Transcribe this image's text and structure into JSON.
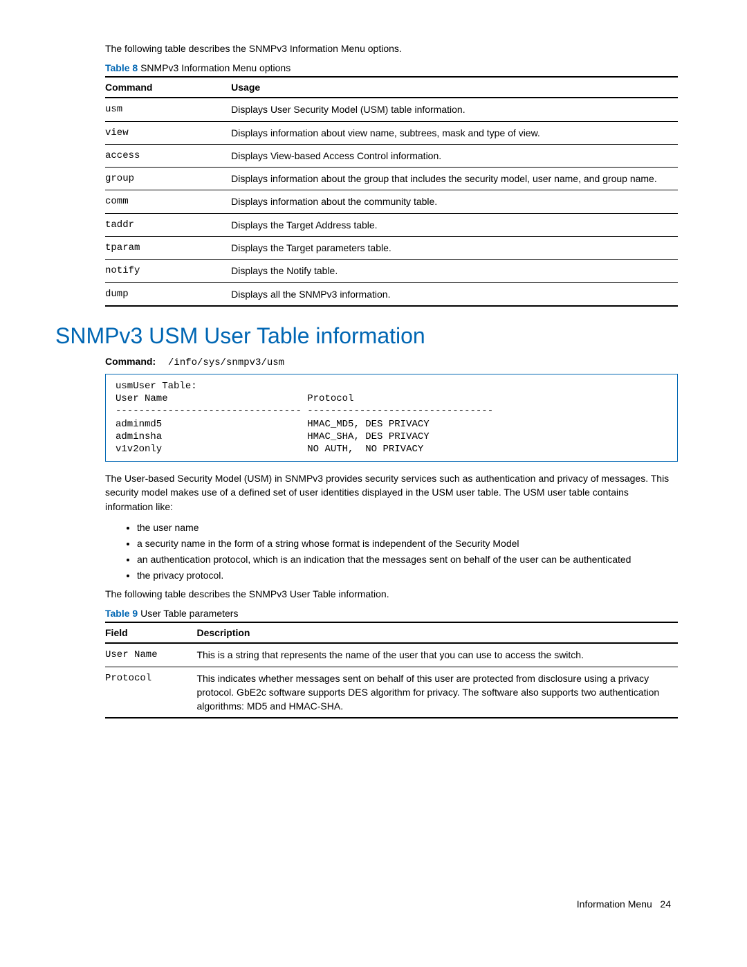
{
  "intro1": "The following table describes the SNMPv3 Information Menu options.",
  "table8": {
    "label": "Table 8",
    "title": "SNMPv3 Information Menu options",
    "headers": {
      "command": "Command",
      "usage": "Usage"
    },
    "rows": [
      {
        "command": "usm",
        "usage": "Displays User Security Model (USM) table information."
      },
      {
        "command": "view",
        "usage": "Displays information about view name, subtrees, mask and type of view."
      },
      {
        "command": "access",
        "usage": "Displays View-based Access Control information."
      },
      {
        "command": "group",
        "usage": "Displays information about the group that includes the security model, user name, and group name."
      },
      {
        "command": "comm",
        "usage": "Displays information about the community table."
      },
      {
        "command": "taddr",
        "usage": "Displays the Target Address table."
      },
      {
        "command": "tparam",
        "usage": "Displays the Target parameters table."
      },
      {
        "command": "notify",
        "usage": "Displays the Notify table."
      },
      {
        "command": "dump",
        "usage": "Displays all the SNMPv3 information."
      }
    ]
  },
  "heading": "SNMPv3 USM User Table information",
  "command": {
    "label": "Command:",
    "path": "/info/sys/snmpv3/usm"
  },
  "codeblock": "usmUser Table:\nUser Name                        Protocol\n-------------------------------- --------------------------------\nadminmd5                         HMAC_MD5, DES PRIVACY\nadminsha                         HMAC_SHA, DES PRIVACY\nv1v2only                         NO AUTH,  NO PRIVACY",
  "para2": "The User-based Security Model (USM) in SNMPv3 provides security services such as authentication and privacy of messages. This security model makes use of a defined set of user identities displayed in the USM user table. The USM user table contains information like:",
  "bullets": [
    "the user name",
    "a security name in the form of a string whose format is independent of the Security Model",
    "an authentication protocol, which is an indication that the messages sent on behalf of the user can be authenticated",
    "the privacy protocol."
  ],
  "para3": "The following table describes the SNMPv3 User Table information.",
  "table9": {
    "label": "Table 9",
    "title": "User Table parameters",
    "headers": {
      "field": "Field",
      "description": "Description"
    },
    "rows": [
      {
        "field": "User Name",
        "description": "This is a string that represents the name of the user that you can use to access the switch."
      },
      {
        "field": "Protocol",
        "description": "This indicates whether messages sent on behalf of this user are protected from disclosure using a privacy protocol. GbE2c software supports DES algorithm for privacy. The software also supports two authentication algorithms: MD5 and HMAC-SHA."
      }
    ]
  },
  "footer": {
    "section": "Information Menu",
    "page": "24"
  }
}
